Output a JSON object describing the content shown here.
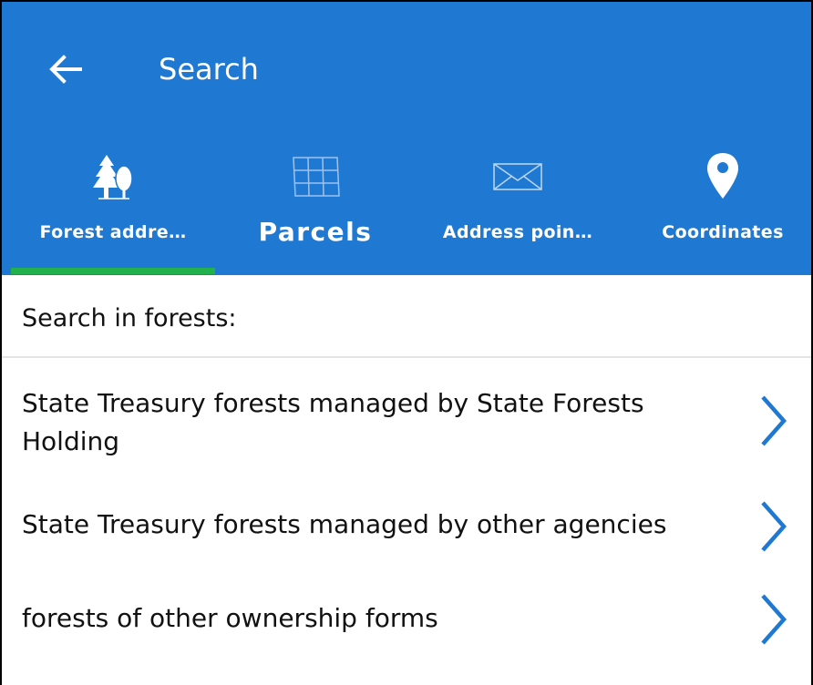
{
  "header": {
    "title": "Search",
    "back_icon": "arrow-left-icon"
  },
  "tabs": [
    {
      "label": "Forest addre…",
      "icon": "trees-icon",
      "selected": true
    },
    {
      "label": "Parcels",
      "icon": "parcel-grid-icon",
      "selected": false
    },
    {
      "label": "Address poin…",
      "icon": "envelope-icon",
      "selected": false
    },
    {
      "label": "Coordinates",
      "icon": "map-pin-icon",
      "selected": false
    }
  ],
  "section": {
    "heading": "Search in forests:"
  },
  "items": [
    {
      "label": "State Treasury forests managed by State Forests Holding",
      "icon": "chevron-right-icon"
    },
    {
      "label": "State Treasury forests managed by other agencies",
      "icon": "chevron-right-icon"
    },
    {
      "label": "forests of other ownership forms",
      "icon": "chevron-right-icon"
    }
  ],
  "colors": {
    "appbar": "#1f78d1",
    "tab_indicator": "#22b14c",
    "chevron": "#1f78d1",
    "text": "#111111"
  }
}
